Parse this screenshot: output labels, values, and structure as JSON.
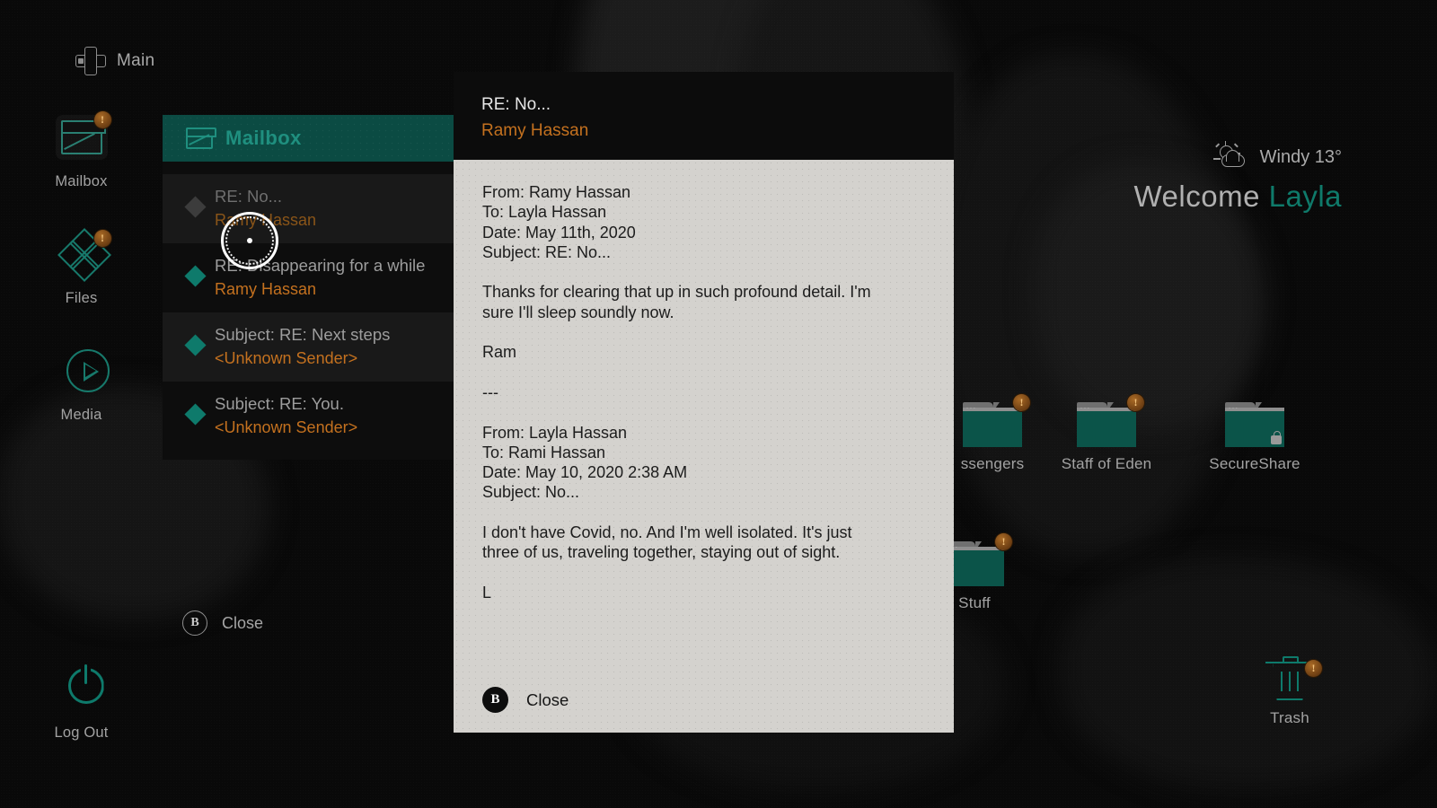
{
  "desktop": {
    "main_label": "Main",
    "weather": {
      "icon": "partly-cloudy-windy-icon",
      "text": "Windy 13°"
    },
    "welcome": {
      "prefix": "Welcome",
      "user": "Layla"
    },
    "folders": [
      {
        "label": "ssengers",
        "badge": "!",
        "locked": false
      },
      {
        "label": "Staff of Eden",
        "badge": "!",
        "locked": false
      },
      {
        "label": "SecureShare",
        "badge": "",
        "locked": true
      },
      {
        "label": "Stuff",
        "badge": "!",
        "locked": false
      }
    ],
    "trash": {
      "label": "Trash",
      "badge": "!"
    }
  },
  "rail": {
    "items": [
      {
        "label": "Mailbox",
        "icon": "mailbox-icon",
        "badge": "!",
        "selected": true
      },
      {
        "label": "Files",
        "icon": "files-icon",
        "badge": "!",
        "selected": false
      },
      {
        "label": "Media",
        "icon": "media-icon",
        "badge": "",
        "selected": false
      }
    ],
    "logout": {
      "label": "Log Out",
      "icon": "power-icon"
    }
  },
  "mailbox": {
    "title": "Mailbox",
    "close_hint": {
      "button": "B",
      "label": "Close"
    },
    "messages": [
      {
        "subject": "RE: No...",
        "sender": "Ramy Hassan",
        "read": true,
        "selected": true
      },
      {
        "subject": "RE: Disappearing for a while",
        "sender": "Ramy Hassan",
        "read": false,
        "selected": false
      },
      {
        "subject": "Subject: RE: Next steps",
        "sender": "<Unknown Sender>",
        "read": false,
        "selected": true
      },
      {
        "subject": "Subject: RE: You.",
        "sender": "<Unknown Sender>",
        "read": false,
        "selected": false
      }
    ]
  },
  "modal": {
    "header": {
      "subject": "RE: No...",
      "sender": "Ramy Hassan"
    },
    "lines": [
      "From: Ramy Hassan",
      "To: Layla Hassan",
      "Date: May 11th, 2020",
      "Subject: RE: No...",
      "",
      "Thanks for clearing that up in such profound detail. I'm",
      "sure I'll sleep soundly now.",
      "",
      "Ram",
      "",
      "---",
      "",
      "From: Layla Hassan",
      "To: Rami Hassan",
      "Date: May 10, 2020 2:38 AM",
      "Subject: No...",
      "",
      "I don't have Covid, no. And I'm well isolated. It's just",
      "three of us, traveling together, staying out of sight.",
      "",
      "L"
    ],
    "footer": {
      "button": "B",
      "label": "Close"
    }
  },
  "colors": {
    "teal": "#0e7a6b",
    "teal_header": "#0b4b43",
    "orange": "#c4711f",
    "paper": "#d4d2ce",
    "badge": "#8a4f18"
  }
}
